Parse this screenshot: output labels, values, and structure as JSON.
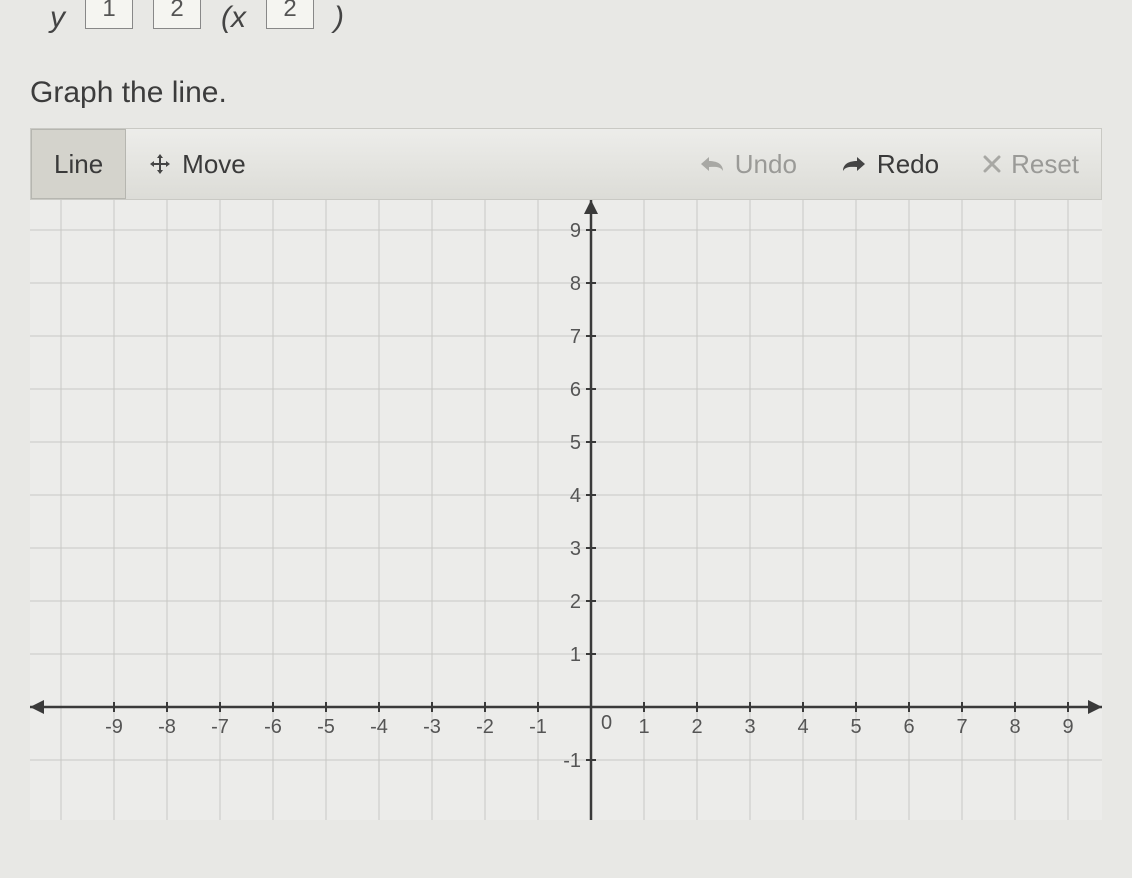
{
  "equation_row": {
    "y_label": "y",
    "box1": "1",
    "box2": "2",
    "x_label": "(x",
    "box3": "2",
    "paren": ")"
  },
  "instruction": "Graph the line.",
  "toolbar": {
    "line": "Line",
    "move": "Move",
    "undo": "Undo",
    "redo": "Redo",
    "reset": "Reset"
  },
  "chart_data": {
    "type": "scatter",
    "title": "",
    "xlabel": "",
    "ylabel": "",
    "xlim": [
      -10,
      10
    ],
    "ylim": [
      -1,
      10
    ],
    "x_ticks": [
      -9,
      -8,
      -7,
      -6,
      -5,
      -4,
      -3,
      -2,
      -1,
      0,
      1,
      2,
      3,
      4,
      5,
      6,
      7,
      8,
      9
    ],
    "y_ticks": [
      -1,
      1,
      2,
      3,
      4,
      5,
      6,
      7,
      8,
      9
    ],
    "series": [
      {
        "name": "",
        "values": []
      }
    ],
    "grid": true
  }
}
